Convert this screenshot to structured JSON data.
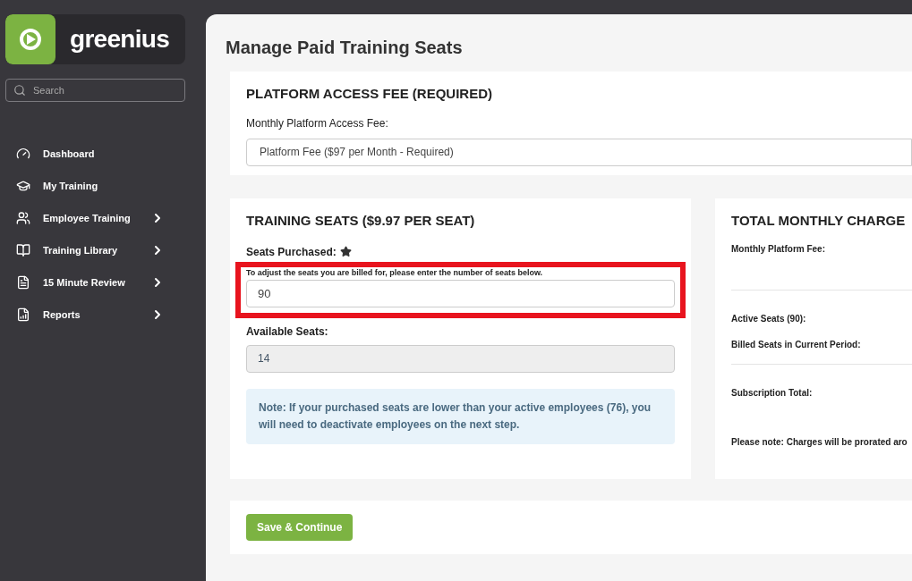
{
  "brand": {
    "name": "greenius"
  },
  "search": {
    "placeholder": "Search"
  },
  "nav": [
    {
      "label": "Dashboard",
      "expandable": false
    },
    {
      "label": "My Training",
      "expandable": false
    },
    {
      "label": "Employee Training",
      "expandable": true
    },
    {
      "label": "Training Library",
      "expandable": true
    },
    {
      "label": "15 Minute Review",
      "expandable": true
    },
    {
      "label": "Reports",
      "expandable": true
    }
  ],
  "page_title": "Manage Paid Training Seats",
  "platform": {
    "heading": "PLATFORM ACCESS FEE (REQUIRED)",
    "label": "Monthly Platform Access Fee:",
    "value": "Platform Fee ($97 per Month - Required)"
  },
  "seats": {
    "heading": "TRAINING SEATS ($9.97 PER SEAT)",
    "purchased_label": "Seats Purchased:",
    "hint": "To adjust the seats you are billed for, please enter the number of seats below.",
    "purchased_value": "90",
    "available_label": "Available Seats:",
    "available_value": "14",
    "note": "Note: If your purchased seats are lower than your active employees (76), you will need to deactivate employees on the next step."
  },
  "total": {
    "heading": "TOTAL MONTHLY CHARGE",
    "groups": [
      [
        "Monthly Platform Fee:"
      ],
      [
        "Active Seats (90):",
        "Billed Seats in Current Period:"
      ],
      [
        "Subscription Total:",
        "Please note: Charges will be prorated aro"
      ]
    ]
  },
  "save_button": "Save & Continue"
}
